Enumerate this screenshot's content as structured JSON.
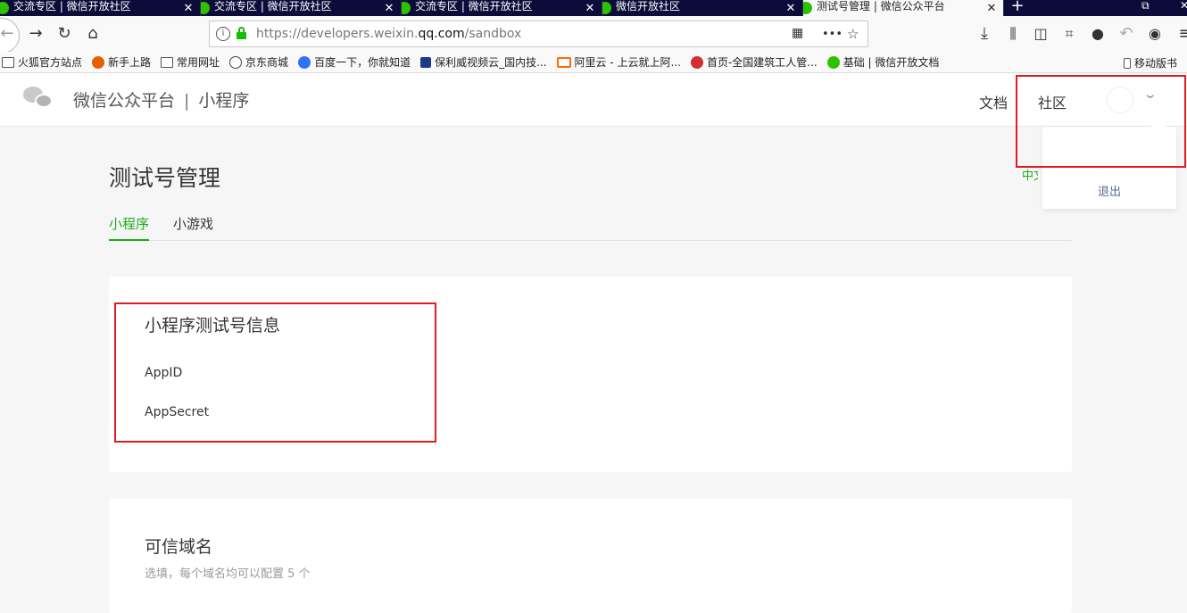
{
  "browser": {
    "tabs": [
      {
        "title": "交流专区 | 微信开放社区",
        "active": false
      },
      {
        "title": "交流专区 | 微信开放社区",
        "active": false
      },
      {
        "title": "交流专区 | 微信开放社区",
        "active": false
      },
      {
        "title": "微信开放社区",
        "active": false
      },
      {
        "title": "测试号管理 | 微信公众平台",
        "active": true
      }
    ],
    "new_tab": "+",
    "url_prefix": "https://developers.weixin.",
    "url_host": "qq.com",
    "url_path": "/sandbox",
    "url_actions": "•••",
    "bookmarks": [
      {
        "label": "火狐官方站点",
        "icon": "folder-icon"
      },
      {
        "label": "新手上路",
        "icon": "firefox-icon"
      },
      {
        "label": "常用网址",
        "icon": "folder-icon"
      },
      {
        "label": "京东商城",
        "icon": "globe-icon"
      },
      {
        "label": "百度一下，你就知道",
        "icon": "baidu-icon"
      },
      {
        "label": "保利威视频云_国内技...",
        "icon": "polyv-icon"
      },
      {
        "label": "阿里云 - 上云就上阿...",
        "icon": "aliyun-icon"
      },
      {
        "label": "首页-全国建筑工人管...",
        "icon": "emblem-icon"
      },
      {
        "label": "基础 | 微信开放文档",
        "icon": "wechat-icon"
      }
    ],
    "mobile_bookmarks": "移动版书"
  },
  "header": {
    "brand": "微信公众平台",
    "separator": "|",
    "product": "小程序",
    "nav_docs": "文档",
    "nav_community": "社区",
    "dropdown_logout": "退出"
  },
  "page": {
    "title": "测试号管理",
    "lang_switch": "中文",
    "tabs": [
      "小程序",
      "小游戏"
    ],
    "info_card": {
      "title": "小程序测试号信息",
      "appid_label": "AppID",
      "appsecret_label": "AppSecret"
    },
    "domain_card": {
      "title": "可信域名",
      "hint": "选填，每个域名均可以配置 5 个"
    }
  },
  "colors": {
    "accent": "#1aad19",
    "annotation_red": "#e21d1d",
    "link": "#576b95"
  }
}
